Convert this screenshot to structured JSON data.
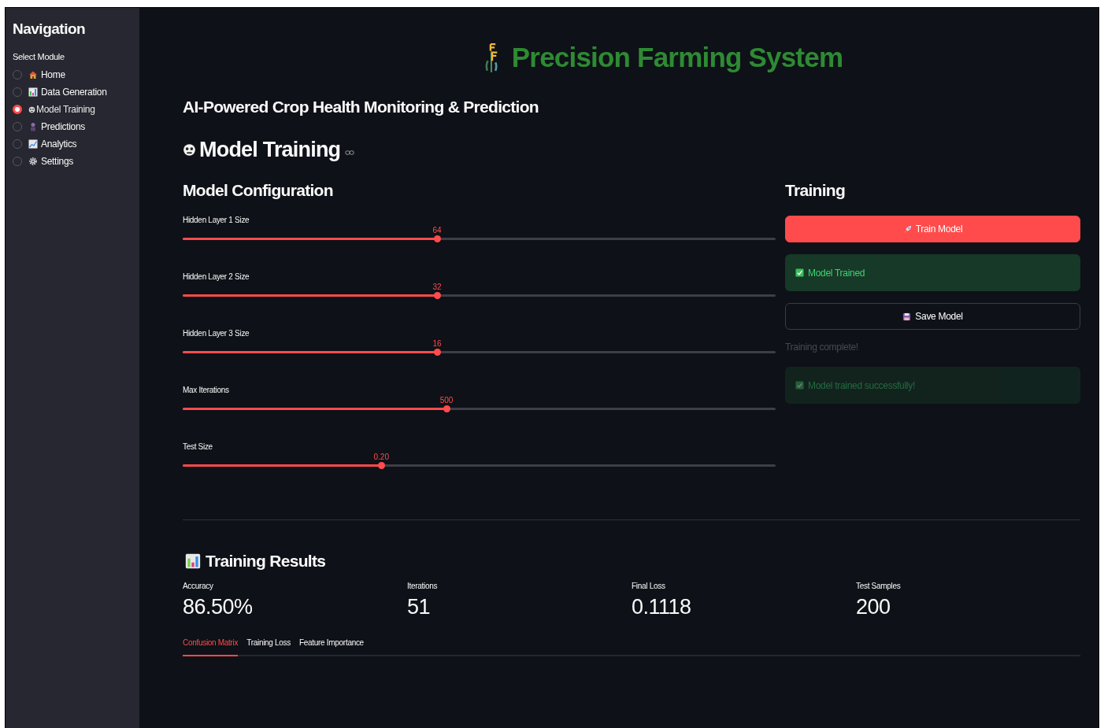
{
  "sidebar": {
    "title": "Navigation",
    "label": "Select Module",
    "items": [
      {
        "label": "Home",
        "selected": false
      },
      {
        "label": "Data Generation",
        "selected": false
      },
      {
        "label": "Model Training",
        "selected": true
      },
      {
        "label": "Predictions",
        "selected": false
      },
      {
        "label": "Analytics",
        "selected": false
      },
      {
        "label": "Settings",
        "selected": false
      }
    ]
  },
  "header": {
    "title": "Precision Farming System",
    "subtitle": "AI-Powered Crop Health Monitoring & Prediction"
  },
  "page_title": "Model Training",
  "config": {
    "title": "Model Configuration",
    "sliders": [
      {
        "label": "Hidden Layer 1 Size",
        "value": "64",
        "level": 0.429
      },
      {
        "label": "Hidden Layer 2 Size",
        "value": "32",
        "level": 0.429
      },
      {
        "label": "Hidden Layer 3 Size",
        "value": "16",
        "level": 0.429
      },
      {
        "label": "Max Iterations",
        "value": "500",
        "level": 0.445
      },
      {
        "label": "Test Size",
        "value": "0.20",
        "level": 0.335
      }
    ]
  },
  "training": {
    "title": "Training",
    "items": [
      {
        "kind": "primary-button",
        "text": "Train Model",
        "faded": false
      },
      {
        "kind": "success",
        "text": "Model Trained",
        "faded": false
      },
      {
        "kind": "secondary-button",
        "text": "Save Model",
        "faded": false
      },
      {
        "kind": "caption",
        "text": "Training complete!",
        "faded": true
      },
      {
        "kind": "success",
        "text": "Model trained successfully!",
        "faded": true
      }
    ]
  },
  "results": {
    "title": "Training Results",
    "metrics": [
      {
        "label": "Accuracy",
        "value": "86.50%"
      },
      {
        "label": "Iterations",
        "value": "51"
      },
      {
        "label": "Final Loss",
        "value": "0.1118"
      },
      {
        "label": "Test Samples",
        "value": "200"
      }
    ],
    "tabs": [
      {
        "label": "Confusion Matrix",
        "selected": true
      },
      {
        "label": "Training Loss",
        "selected": false
      },
      {
        "label": "Feature Importance",
        "selected": false
      }
    ]
  }
}
